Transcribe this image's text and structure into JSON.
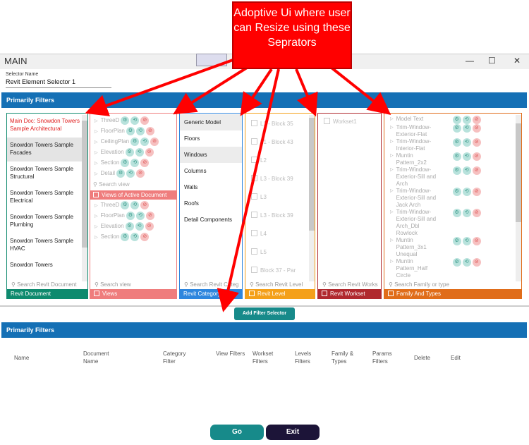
{
  "window": {
    "title": "MAIN",
    "min": "—",
    "max": "☐",
    "close": "✕"
  },
  "selector": {
    "label": "Selector Name",
    "value": "Revit Element Selector 1"
  },
  "bars": {
    "top": "Primarily Filters",
    "bottom": "Primarily Filters"
  },
  "callout": "Adoptive Ui where user can Resize using these Seprators",
  "documents": {
    "items": [
      "Main Doc: Snowdon Towers Sample Architectural",
      "Snowdon Towers Sample Facades",
      "Snowdon Towers Sample Structural",
      "Snowdon Towers Sample Electrical",
      "Snowdon Towers Sample Plumbing",
      "Snowdon Towers Sample HVAC",
      "Snowdon Towers"
    ],
    "search": "Search Revit Document",
    "footer": "Revit Document",
    "color": "#0e8a6e"
  },
  "views": {
    "items": [
      "ThreeD",
      "FloorPlan",
      "CeilingPlan",
      "Elevation",
      "Section",
      "Detail"
    ],
    "search": "Search view",
    "active_label": "Views of Active Document",
    "active_items": [
      "ThreeD",
      "FloorPlan",
      "Elevation",
      "Section"
    ],
    "search2": "Search view",
    "footer": "Views",
    "color": "#ef7d7d"
  },
  "categories": {
    "items": [
      "Generic Model",
      "Floors",
      "Windows",
      "Columns",
      "Walls",
      "Roofs",
      "Detail Components"
    ],
    "search": "Search Revit Categ",
    "footer": "Revit Category",
    "color": "#2e86de"
  },
  "levels": {
    "items": [
      "L1 - Block 35",
      "L1 - Block 43",
      "L2",
      "L3 - Block 39",
      "L3",
      "L3 - Block 39",
      "L4",
      "L5",
      "Block 37 - Par"
    ],
    "search": "Search Revit Level",
    "footer": "Revit Level",
    "color": "#f4a019"
  },
  "worksets": {
    "items": [
      "Workset1"
    ],
    "search": "Search Revit Works",
    "footer": "Revit Workset",
    "color": "#b0292e"
  },
  "families": {
    "items": [
      "Model Text",
      "Trim-Window-Exterior-Flat",
      "Trim-Window-Interior-Flat",
      "Muntin Pattern_2x2",
      "Trim-Window-Exterior-Sill and Arch",
      "Trim-Window-Exterior-Sill and Jack Arch",
      "Trim-Window-Exterior-Sill and Arch_Dbl Rowlock",
      "Muntin Pattern_3x1 Unequal",
      "Muntin Pattern_Half Circle"
    ],
    "search": "Search Family or type",
    "footer": "Family And Types",
    "color": "#e06d1a"
  },
  "add_button": "Add Filter Selector",
  "columns": [
    "Name",
    "Document Name",
    "Category Filter",
    "View Filters",
    "Workset Filters",
    "Levels Filters",
    "Family & Types",
    "Params Filters",
    "Delete",
    "Edit"
  ],
  "go": "Go",
  "exit": "Exit",
  "colors": {
    "accent": "#1570b5",
    "go": "#178a8a",
    "exit": "#1c1438",
    "callout": "#ff0000"
  }
}
